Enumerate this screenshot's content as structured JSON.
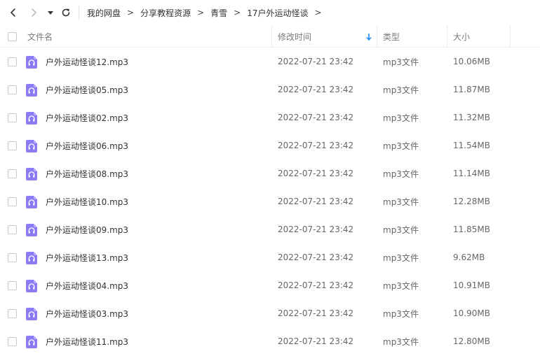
{
  "colors": {
    "accent": "#1e90ff",
    "file_icon": "#8b7cf6",
    "header_text": "#7a7a7a"
  },
  "nav": {
    "back_icon": "chevron-left-icon",
    "forward_icon": "chevron-right-icon",
    "dropdown_icon": "caret-down-icon",
    "refresh_icon": "refresh-icon"
  },
  "breadcrumb": [
    {
      "label": "我的网盘"
    },
    {
      "label": "分享教程资源"
    },
    {
      "label": "青雪"
    },
    {
      "label": "17户外运动怪谈"
    }
  ],
  "breadcrumb_separator": ">",
  "table": {
    "columns": {
      "name": "文件名",
      "modified": "修改时间",
      "type": "类型",
      "size": "大小"
    },
    "sort_icon": "sort-down-arrow-icon",
    "rows": [
      {
        "name": "户外运动怪谈12.mp3",
        "modified": "2022-07-21 23:42",
        "type": "mp3文件",
        "size": "10.06MB"
      },
      {
        "name": "户外运动怪谈05.mp3",
        "modified": "2022-07-21 23:42",
        "type": "mp3文件",
        "size": "11.87MB"
      },
      {
        "name": "户外运动怪谈02.mp3",
        "modified": "2022-07-21 23:42",
        "type": "mp3文件",
        "size": "11.32MB"
      },
      {
        "name": "户外运动怪谈06.mp3",
        "modified": "2022-07-21 23:42",
        "type": "mp3文件",
        "size": "11.54MB"
      },
      {
        "name": "户外运动怪谈08.mp3",
        "modified": "2022-07-21 23:42",
        "type": "mp3文件",
        "size": "11.14MB"
      },
      {
        "name": "户外运动怪谈10.mp3",
        "modified": "2022-07-21 23:42",
        "type": "mp3文件",
        "size": "12.28MB"
      },
      {
        "name": "户外运动怪谈09.mp3",
        "modified": "2022-07-21 23:42",
        "type": "mp3文件",
        "size": "11.85MB"
      },
      {
        "name": "户外运动怪谈13.mp3",
        "modified": "2022-07-21 23:42",
        "type": "mp3文件",
        "size": "9.62MB"
      },
      {
        "name": "户外运动怪谈04.mp3",
        "modified": "2022-07-21 23:42",
        "type": "mp3文件",
        "size": "10.91MB"
      },
      {
        "name": "户外运动怪谈03.mp3",
        "modified": "2022-07-21 23:42",
        "type": "mp3文件",
        "size": "10.90MB"
      },
      {
        "name": "户外运动怪谈11.mp3",
        "modified": "2022-07-21 23:42",
        "type": "mp3文件",
        "size": "12.80MB"
      }
    ]
  }
}
